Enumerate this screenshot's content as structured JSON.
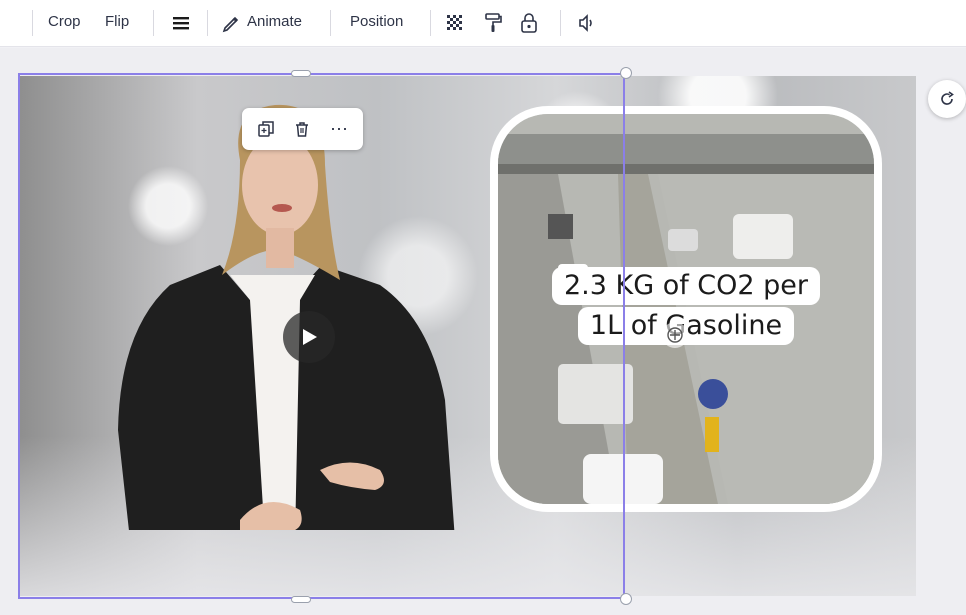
{
  "toolbar": {
    "crop_label": "Crop",
    "flip_label": "Flip",
    "animate_label": "Animate",
    "position_label": "Position",
    "icons": [
      "menu-lines-icon",
      "animate-pencil-icon",
      "transparency-icon",
      "paint-roller-icon",
      "lock-icon",
      "volume-icon"
    ]
  },
  "canvas": {
    "caption_line1": "2.3 KG of CO2 per",
    "caption_line2": "1L of Gasoline"
  },
  "floating_menu": {
    "icons": [
      "duplicate-icon",
      "delete-icon",
      "more-icon"
    ],
    "more_label": "⋯"
  },
  "colors": {
    "selection": "#8b7fe8",
    "toolbar_text": "#2e3447",
    "canvas_bg": "#eeeef2"
  }
}
